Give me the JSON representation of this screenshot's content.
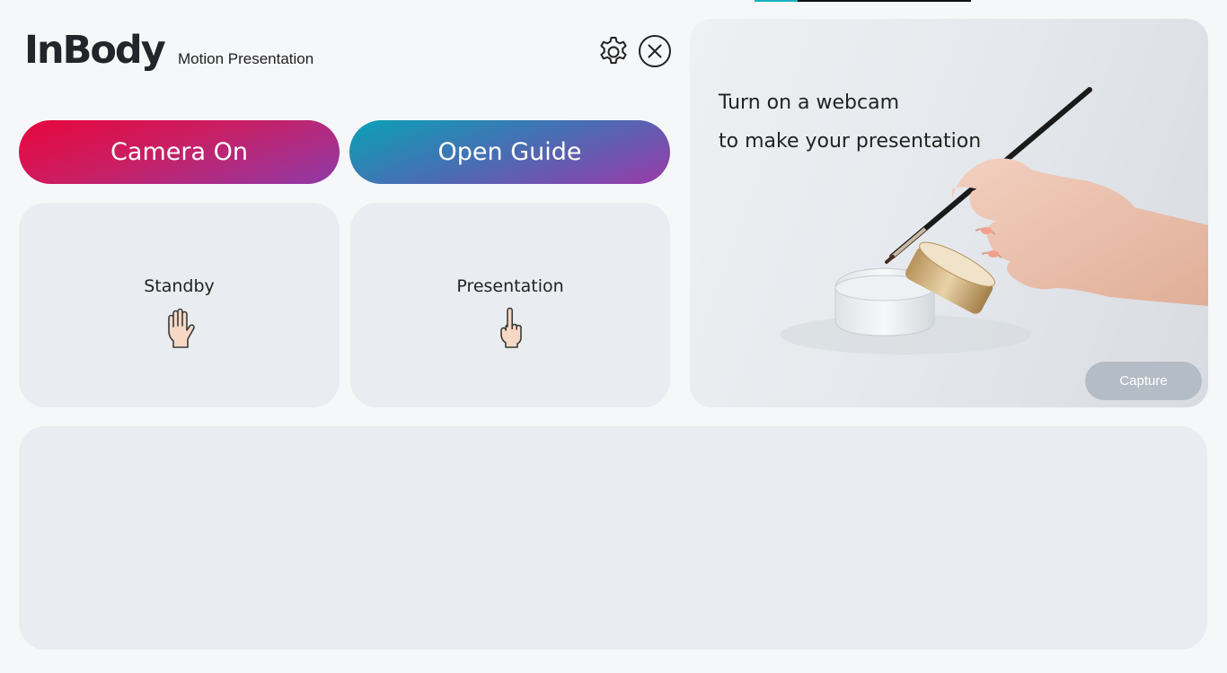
{
  "app": {
    "logo_text": "InBody",
    "subtitle": "Motion Presentation"
  },
  "toolbar": {
    "settings_icon": "gear-icon",
    "close_icon": "close-circle-icon"
  },
  "actions": {
    "camera_label": "Camera On",
    "guide_label": "Open Guide"
  },
  "modes": {
    "standby": {
      "label": "Standby",
      "icon": "open-hand-icon"
    },
    "presentation": {
      "label": "Presentation",
      "icon": "pointing-finger-icon"
    }
  },
  "preview": {
    "line1": "Turn on a webcam",
    "line2": "to make your presentation",
    "capture_label": "Capture"
  },
  "colors": {
    "camera_gradient": [
      "#e8063c",
      "#8f3aa8"
    ],
    "guide_gradient": [
      "#0aa1b6",
      "#9a3aa8"
    ],
    "card_bg": "#e9ecf0",
    "capture_bg": "#b4bcc6"
  }
}
